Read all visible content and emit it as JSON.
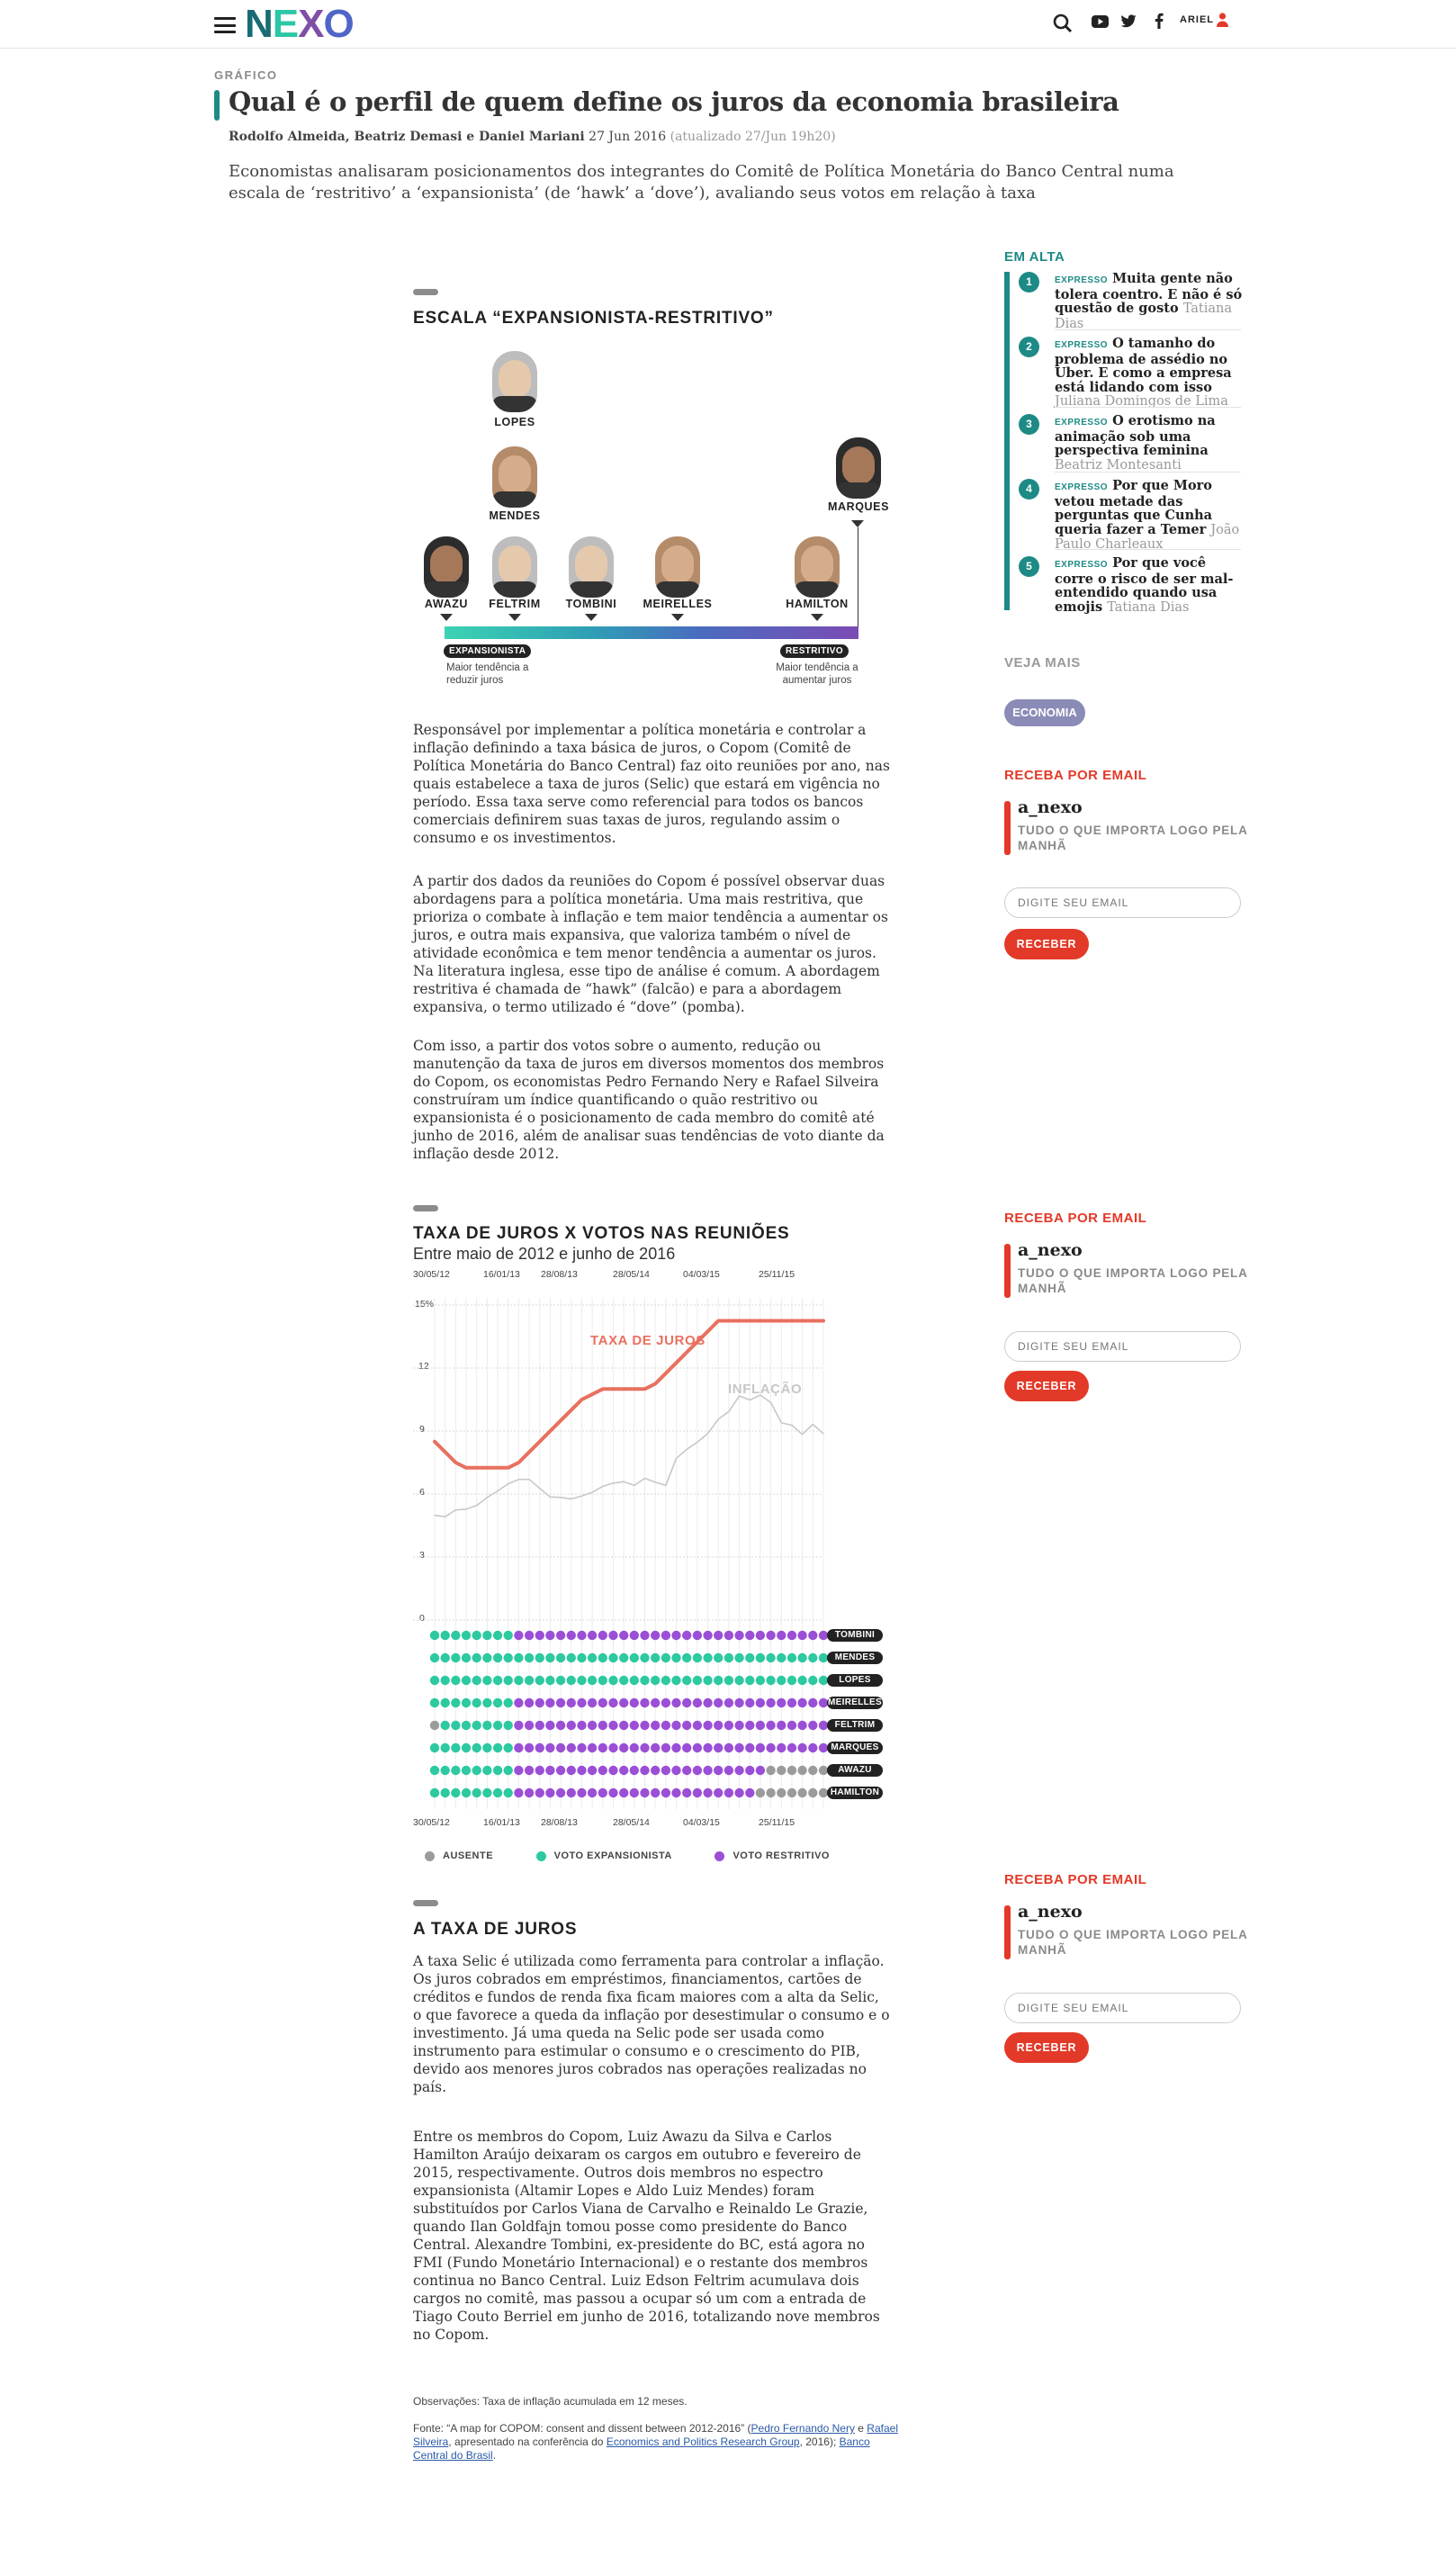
{
  "header": {
    "user": "ARIEL",
    "logo": {
      "n": "N",
      "e": "E",
      "x": "X",
      "o": "O"
    }
  },
  "article": {
    "kicker": "GRÁFICO",
    "title": "Qual é o perfil de quem define os juros da economia brasileira",
    "authors": "Rodolfo Almeida, Beatriz Demasi e Daniel Mariani",
    "date": "27 Jun 2016",
    "updated": "(atualizado 27/Jun 19h20)",
    "lead": "Economistas analisaram posicionamentos dos integrantes do Comitê de Política Monetária do Banco Central numa escala de ‘restritivo’ a ‘expansionista’ (de ‘hawk’ a ‘dove’), avaliando seus votos em relação à taxa"
  },
  "scale": {
    "title": "ESCALA “EXPANSIONISTA-RESTRITIVO”",
    "people": [
      "LOPES",
      "MENDES",
      "MARQUES",
      "AWAZU",
      "FELTRIM",
      "TOMBINI",
      "MEIRELLES",
      "HAMILTON"
    ],
    "left_pill": "EXPANSIONISTA",
    "left_note": "Maior tendência a reduzir juros",
    "right_pill": "RESTRITIVO",
    "right_note": "Maior tendência a aumentar juros",
    "colors": {
      "start": "#3bd4b3",
      "end": "#7b4bb5"
    }
  },
  "body": {
    "p1": "Responsável por implementar a política monetária e controlar a inflação definindo a taxa básica de juros, o Copom (Comitê de Política Monetária do Banco Central) faz oito reuniões por ano, nas quais estabelece a taxa de juros (Selic) que estará em vigência no período. Essa taxa serve como referencial para todos os bancos comerciais definirem suas taxas de juros, regulando assim o consumo e os investimentos.",
    "p2": "A partir dos dados da reuniões do Copom é possível observar duas abordagens para a política monetária. Uma mais restritiva, que prioriza o combate à inflação e tem maior tendência a aumentar os juros, e outra mais expansiva, que valoriza também o nível de atividade econômica e tem menor tendência a aumentar os juros. Na literatura inglesa, esse tipo de análise é comum. A abordagem restritiva é chamada de “hawk” (falcão) e para a abordagem expansiva, o termo utilizado é “dove” (pomba).",
    "p3": "Com isso, a partir dos votos sobre o aumento, redução ou manutenção da taxa de juros em diversos momentos dos membros do Copom, os economistas Pedro Fernando Nery e Rafael Silveira construíram um índice quantificando o quão restritivo ou expansionista é o posicionamento de cada membro do comitê até junho de 2016, além de analisar suas tendências de voto diante da inflação desde 2012.",
    "s3title": "A TAXA DE JUROS",
    "p4": "A taxa Selic é utilizada como ferramenta para controlar a inflação. Os juros cobrados em empréstimos, financiamentos, cartões de créditos e fundos de renda fixa ficam maiores com a alta da Selic, o que favorece a queda da inflação por desestimular o consumo e o investimento. Já uma queda na Selic pode ser usada como instrumento para estimular o consumo e o crescimento do PIB, devido aos menores juros cobrados nas operações realizadas no país.",
    "p5": "Entre os membros do Copom, Luiz Awazu da Silva e Carlos Hamilton Araújo deixaram os cargos em outubro e fevereiro de 2015, respectivamente. Outros dois membros no espectro expansionista (Altamir Lopes e Aldo Luiz Mendes) foram substituídos por Carlos Viana de Carvalho e Reinaldo Le Grazie, quando Ilan Goldfajn tomou posse como presidente do Banco Central. Alexandre Tombini, ex-presidente do BC, está agora no FMI (Fundo Monetário Internacional) e o restante dos membros continua no Banco Central. Luiz Edson Feltrim acumulava dois cargos no comitê, mas passou a ocupar só um com a entrada de Tiago Couto Berriel em junho de 2016, totalizando nove membros no Copom.",
    "obs": "Observações: Taxa de inflação acumulada em 12 meses.",
    "fonte_pre": "Fonte: “A map for COPOM: consent and dissent between 2012-2016” (",
    "fonte_l1": "Pedro Fernando Nery",
    "fonte_mid": " e ",
    "fonte_l2": "Rafael Silveira",
    "fonte_mid2": ", apresentado na conferência do ",
    "fonte_l3": "Economics and Politics Research Group",
    "fonte_mid3": ", 2016); ",
    "fonte_l4": "Banco Central do Brasil",
    "fonte_end": "."
  },
  "chart_data": {
    "type": "line",
    "title": "TAXA DE JUROS X VOTOS NAS REUNIÕES",
    "subtitle": "Entre maio de 2012 e junho de 2016",
    "x_ticks": [
      "30/05/12",
      "16/01/13",
      "28/08/13",
      "28/05/14",
      "04/03/15",
      "25/11/15"
    ],
    "y_ticks": [
      "15%",
      "12",
      "9",
      "6",
      "3",
      "0"
    ],
    "ylim": [
      0,
      15
    ],
    "series": [
      {
        "name": "TAXA DE JUROS",
        "color": "#e8705f",
        "values": [
          8.5,
          8,
          7.5,
          7.25,
          7.25,
          7.25,
          7.25,
          7.25,
          7.5,
          8,
          8.5,
          9,
          9.5,
          10,
          10.5,
          10.75,
          11,
          11,
          11,
          11,
          11,
          11.25,
          11.75,
          12.25,
          12.75,
          13.25,
          13.75,
          14.25,
          14.25,
          14.25,
          14.25,
          14.25,
          14.25,
          14.25,
          14.25,
          14.25,
          14.25,
          14.25
        ]
      },
      {
        "name": "INFLAÇÃO",
        "color": "#c8c8c8",
        "values": [
          4.99,
          4.92,
          5.24,
          5.28,
          5.45,
          5.84,
          6.15,
          6.49,
          6.7,
          6.7,
          6.27,
          5.86,
          5.84,
          5.77,
          5.91,
          6.08,
          6.37,
          6.52,
          6.59,
          6.41,
          6.75,
          6.56,
          6.41,
          7.7,
          8.13,
          8.47,
          8.89,
          9.56,
          9.93,
          10.67,
          10.48,
          10.71,
          10.36,
          9.39,
          9.28,
          8.84,
          9.32,
          8.88
        ]
      }
    ],
    "members": [
      "TOMBINI",
      "MENDES",
      "LOPES",
      "MEIRELLES",
      "FELTRIM",
      "MARQUES",
      "AWAZU",
      "HAMILTON"
    ],
    "votes": [
      "EEEEEEEERRRRRRRRRRRRRRRRRRRRRRRRRRRRRR",
      "EEEEEEEEEEEEEEEEEEEEEEEEEEEEEEEEEEEEEE",
      "EEEEEEEEEEEEEEEEEEEEEEEEEEEEEEEEEEEEEE",
      "EEEEEEEERRRRRRRRRRRRRRRRRRRRRRRRRRRRRR",
      "AEEEEEEERRRRRRRRRRRRRRRRRRRRRRRRRRRRRR",
      "EEEEEEEERRRRRRRRRRRRRRRRRRRRRRRRRRRRRR",
      "EEEEEEEERRRRRRRRRRRRRRRRRRRRRRRRAAAAAA",
      "EEEEEEEERRRRRRRRRRRRRRRRRRRRRRRAAAAAAA"
    ],
    "legend": [
      "AUSENTE",
      "VOTO EXPANSIONISTA",
      "VOTO RESTRITIVO"
    ],
    "vote_colors": {
      "A": "#9b9b9b",
      "E": "#2dc9a0",
      "R": "#9b4fd6"
    }
  },
  "sidebar": {
    "trending_title": "EM ALTA",
    "trending": [
      {
        "n": "1",
        "tag": "EXPRESSO",
        "title": "Muita gente não tolera coentro. E não é só questão de gosto",
        "author": "Tatiana Dias"
      },
      {
        "n": "2",
        "tag": "EXPRESSO",
        "title": "O tamanho do problema de assédio no Uber. E como a empresa está lidando com isso",
        "author": "Juliana Domingos de Lima"
      },
      {
        "n": "3",
        "tag": "EXPRESSO",
        "title": "O erotismo na animação sob uma perspectiva feminina",
        "author": "Beatriz Montesanti"
      },
      {
        "n": "4",
        "tag": "EXPRESSO",
        "title": "Por que Moro vetou metade das perguntas que Cunha queria fazer a Temer",
        "author": "João Paulo Charleaux"
      },
      {
        "n": "5",
        "tag": "EXPRESSO",
        "title": "Por que você corre o risco de ser mal-entendido quando usa emojis",
        "author": "Tatiana Dias"
      }
    ],
    "see_more": "VEJA MAIS",
    "see_more_tag": "ECONOMIA",
    "newsletter": {
      "title": "RECEBA POR EMAIL",
      "name": "a_nexo",
      "sub": "TUDO O QUE IMPORTA LOGO PELA MANHÃ",
      "placeholder": "DIGITE SEU EMAIL",
      "button": "RECEBER"
    },
    "accent": "#e33928",
    "teal": "#1d8a85"
  }
}
